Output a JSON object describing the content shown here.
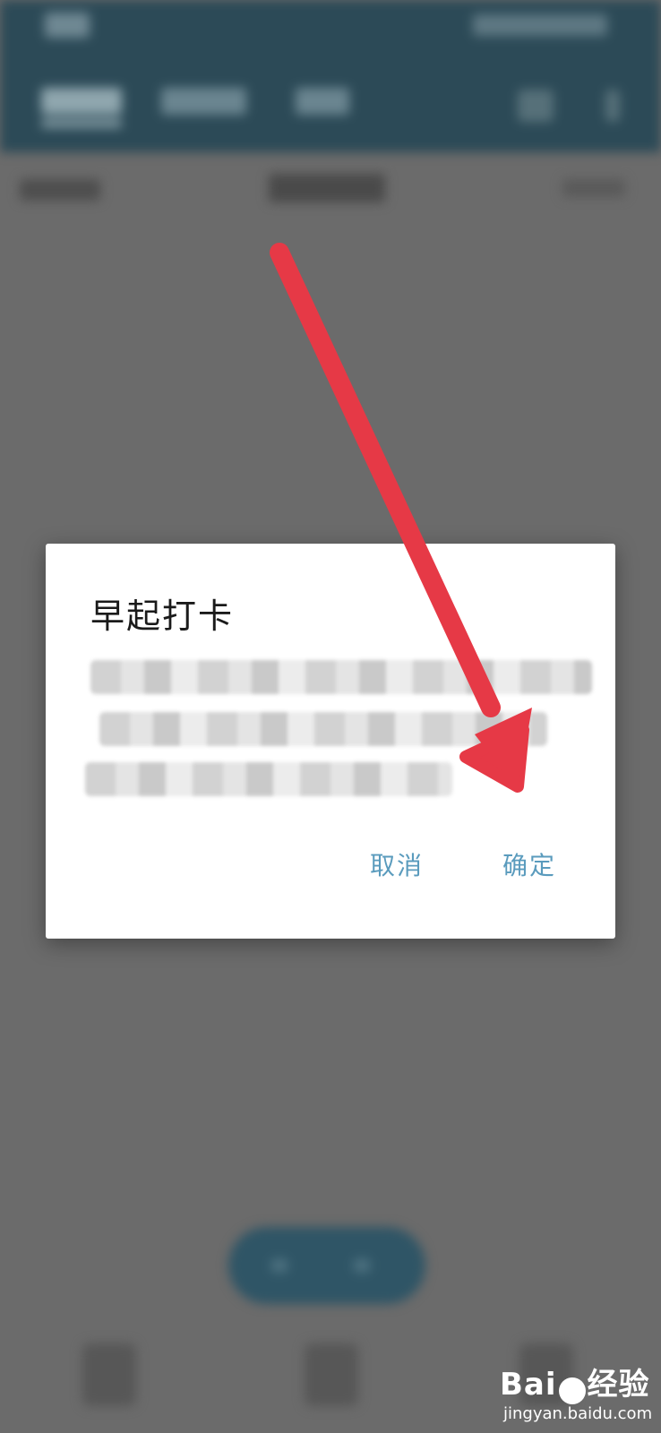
{
  "dialog": {
    "title": "早起打卡",
    "cancel_label": "取消",
    "confirm_label": "确定"
  },
  "watermark": {
    "brand": "Bai",
    "brand_cn": "经验",
    "site": "jingyan.baidu.com"
  },
  "colors": {
    "dialog_button": "#5a9bbd",
    "header": "#2c4a57",
    "annotation_arrow": "#e63946"
  },
  "icons": [
    "annotation-arrow-icon",
    "baidu-paw-icon"
  ]
}
